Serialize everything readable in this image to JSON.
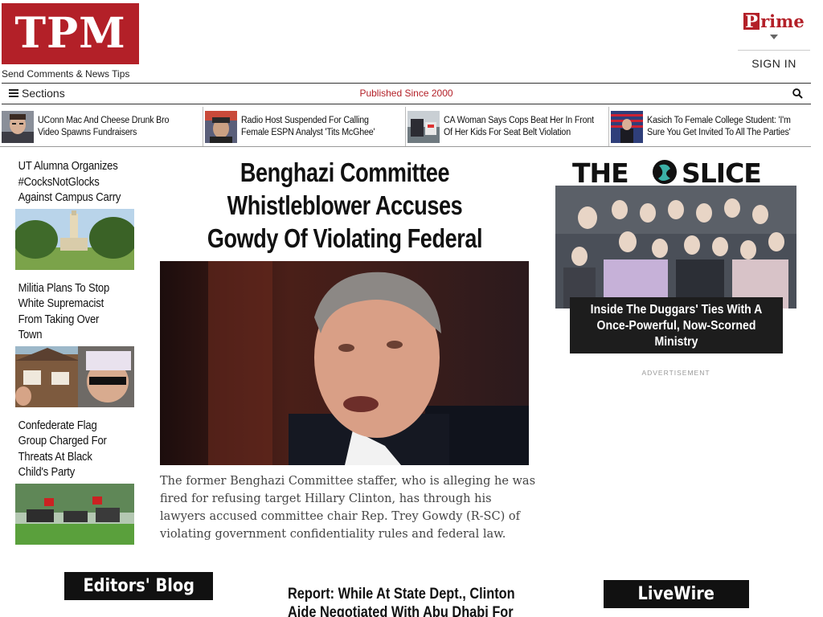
{
  "header": {
    "logo_text": "TPM",
    "tips_link": "Send Comments & News Tips",
    "prime_logo": "Prime",
    "prime_logo_first": "P",
    "prime_logo_rest": "rime",
    "sign_in": "SIGN IN"
  },
  "nav": {
    "sections_label": "Sections",
    "tagline": "Published Since 2000",
    "icons": [
      "menu-icon",
      "search-icon"
    ]
  },
  "strip": [
    {
      "title": "UConn Mac And Cheese Drunk Bro Video Spawns Fundraisers"
    },
    {
      "title": "Radio Host Suspended For Calling Female ESPN Analyst 'Tits McGhee'"
    },
    {
      "title": "CA Woman Says Cops Beat Her In Front Of Her Kids For Seat Belt Violation"
    },
    {
      "title": "Kasich To Female College Student: 'I'm Sure You Get Invited To All The Parties'"
    }
  ],
  "left_stories": [
    {
      "title": "UT Alumna Organizes #CocksNotGlocks Against Campus Carry"
    },
    {
      "title": "Militia Plans To Stop White Supremacist From Taking Over Town"
    },
    {
      "title": "Confederate Flag Group Charged For Threats At Black Child's Party"
    }
  ],
  "main_story": {
    "headline": "Benghazi Committee Whistleblower Accuses Gowdy Of Violating Federal Law",
    "dek": "The former Benghazi Committee staffer, who is alleging he was fired for refusing target Hillary Clinton, has through his lawyers accused committee chair Rep. Trey Gowdy (R-SC) of violating government confidentiality rules and federal law."
  },
  "slice": {
    "logo_text": "THE SLICE",
    "caption": "Inside The Duggars' Ties With A Once-Powerful, Now-Scorned Ministry",
    "advertisement": "ADVERTISEMENT"
  },
  "bottom": {
    "editors_blog": "Editors' Blog",
    "report_headline_line1": "Report: While At State Dept., Clinton",
    "report_headline_line2": "Aide Negotiated With Abu Dhabi For",
    "livewire": "LiveWire"
  },
  "colors": {
    "brand_red": "#b32028",
    "dark_box": "#111111"
  }
}
